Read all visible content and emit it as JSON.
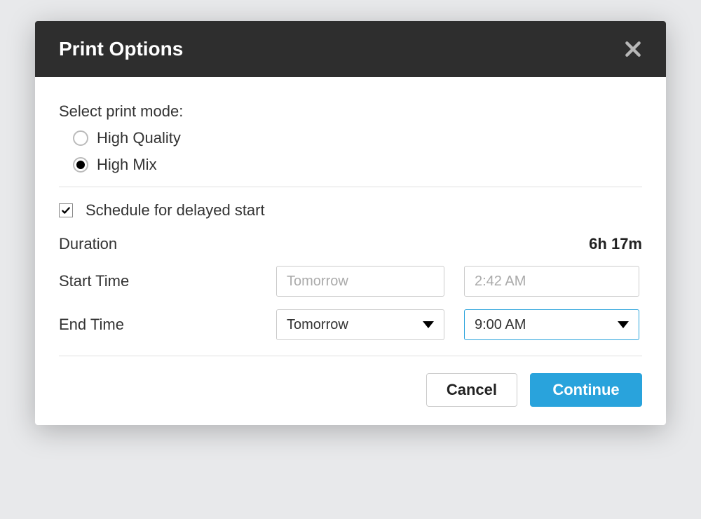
{
  "dialog": {
    "title": "Print Options"
  },
  "mode": {
    "label": "Select print mode:",
    "options": {
      "high_quality": "High Quality",
      "high_mix": "High Mix"
    },
    "selected": "high_mix"
  },
  "schedule": {
    "checkbox_label": "Schedule for delayed start",
    "checked": true,
    "duration_label": "Duration",
    "duration_value": "6h 17m",
    "start_label": "Start Time",
    "start_date": "Tomorrow",
    "start_time": "2:42 AM",
    "end_label": "End Time",
    "end_date": "Tomorrow",
    "end_time": "9:00 AM"
  },
  "buttons": {
    "cancel": "Cancel",
    "continue": "Continue"
  }
}
